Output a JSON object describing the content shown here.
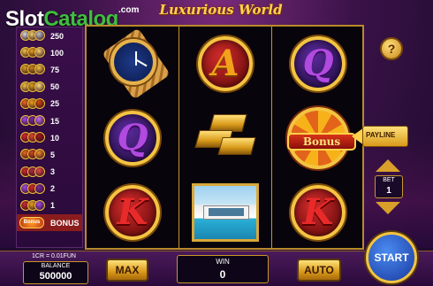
{
  "logo": {
    "text_slot": "Slot",
    "text_catalog": "Catalog",
    "suffix": ".com"
  },
  "game": {
    "title": "Luxurious World"
  },
  "paytable": {
    "rows": [
      {
        "value": "250",
        "colors": [
          "#d8d8d8",
          "#f0d070",
          "#c0c0c0"
        ]
      },
      {
        "value": "100",
        "colors": [
          "#f2c240",
          "#e8a020",
          "#f7d070"
        ]
      },
      {
        "value": "75",
        "colors": [
          "#d8a020",
          "#c8861a",
          "#f2c240"
        ]
      },
      {
        "value": "50",
        "colors": [
          "#f2c240",
          "#d8a020",
          "#ffe07a"
        ]
      },
      {
        "value": "25",
        "colors": [
          "#e86a1a",
          "#f2a21a",
          "#d04a0a"
        ]
      },
      {
        "value": "15",
        "colors": [
          "#a04ae0",
          "#7a2aa0",
          "#c06af0"
        ]
      },
      {
        "value": "10",
        "colors": [
          "#d02a2a",
          "#e04a2a",
          "#a01a1a"
        ]
      },
      {
        "value": "5",
        "colors": [
          "#e86a1a",
          "#d04a1a",
          "#f28a2a"
        ]
      },
      {
        "value": "3",
        "colors": [
          "#d02a2a",
          "#b02a4a",
          "#e04a4a"
        ]
      },
      {
        "value": "2",
        "colors": [
          "#a04ae0",
          "#d02a2a",
          "#7a2aa0"
        ]
      },
      {
        "value": "1",
        "colors": [
          "#d02a2a",
          "#e8a020",
          "#a04ae0"
        ]
      }
    ],
    "bonus": {
      "icon_text": "Bonus",
      "label": "BONUS"
    }
  },
  "reels": {
    "col1": {
      "r1": "watch",
      "r2": "Q",
      "r3": "K"
    },
    "col2": {
      "r1": "A",
      "r2": "gold-bars",
      "r3": "villa"
    },
    "col3": {
      "r1": "Q",
      "r2": "Bonus",
      "r3": "K"
    }
  },
  "controls": {
    "help": "?",
    "payline": "PAYLINE",
    "bet_label": "BET",
    "bet_value": "1",
    "rate": "1CR = 0.01FUN",
    "balance_label": "BALANCE",
    "balance_value": "500000",
    "max": "MAX",
    "win_label": "WIN",
    "win_value": "0",
    "auto": "AUTO",
    "start": "START"
  },
  "colors": {
    "gold": "#f3c442",
    "accent_blue": "#2a5ad0",
    "background": "#3a1248"
  }
}
